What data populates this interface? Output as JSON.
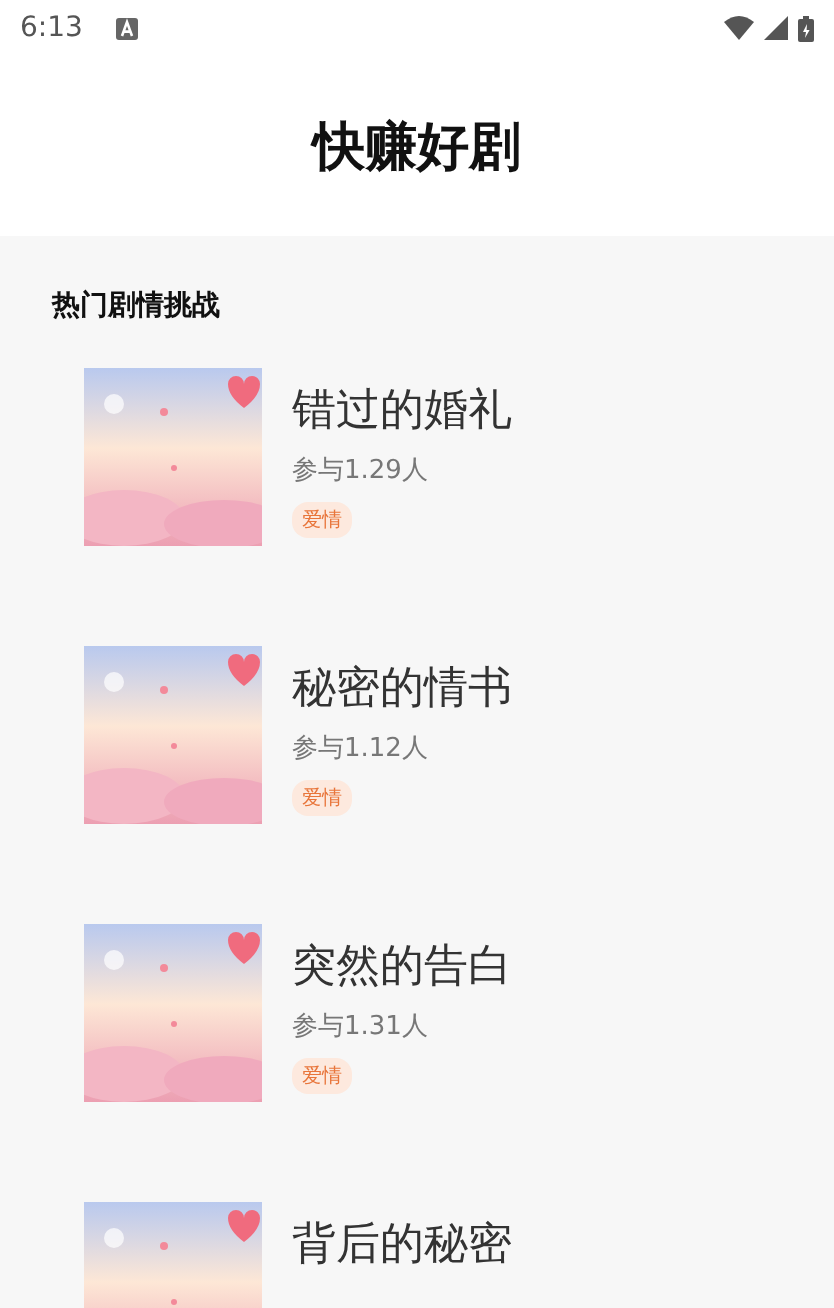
{
  "status_bar": {
    "time": "6:13"
  },
  "header": {
    "title": "快赚好剧"
  },
  "section": {
    "title": "热门剧情挑战"
  },
  "dramas": [
    {
      "title": "错过的婚礼",
      "participants": "参与1.29人",
      "tag": "爱情"
    },
    {
      "title": "秘密的情书",
      "participants": "参与1.12人",
      "tag": "爱情"
    },
    {
      "title": "突然的告白",
      "participants": "参与1.31人",
      "tag": "爱情"
    },
    {
      "title": "背后的秘密"
    }
  ]
}
